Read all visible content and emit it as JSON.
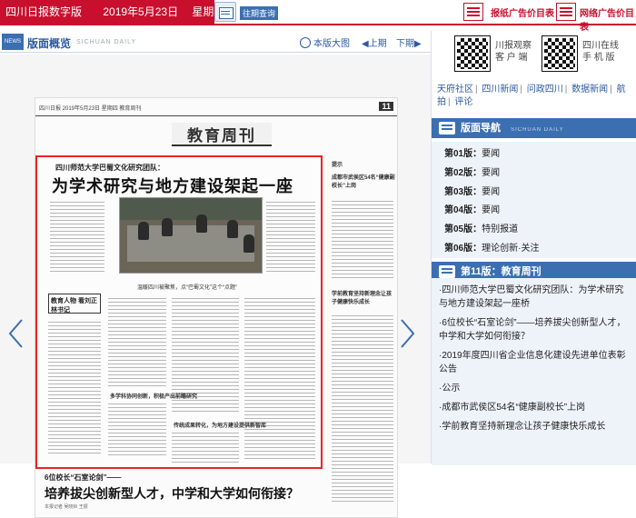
{
  "topbar": {
    "site_name": "四川日报数字版",
    "date": "2019年5月23日",
    "weekday": "星期四",
    "past_issues": "往期查询",
    "ad_price_1": "报纸广告价目表",
    "ad_price_2": "网络广告价目表",
    "news_badge": "NEWS"
  },
  "subheader": {
    "title": "版面概览",
    "title_en": "SICHUAN DAILY",
    "view_big": "本版大图",
    "prev": "◀上期",
    "next": "下期▶"
  },
  "newspaper": {
    "masthead_small": "四川日报  2019年5月23日  星期四  教育周刊",
    "page_num": "11",
    "section_title": "教育周刊",
    "kicker": "四川师范大学巴蜀文化研究团队：",
    "headline": "为学术研究与地方建设架起一座桥",
    "deck": "温暖四川被聚焦，点“巴蜀文化”这个“点题”",
    "sidebox": "教育人物 看刘正林书记",
    "sub1": "多学科协同创新，积极产出前瞻研究",
    "sub2": "传统成果转化，为地方建设提供新智库",
    "bottom_kicker": "6位校长“石室论剑”——",
    "bottom_headline": "培养拔尖创新型人才，中学和大学如何衔接？",
    "bottom_byline": "本报记者 吴晓铃 王振",
    "right_kicker_1": "成都市武侯区54名“健康副校长”上岗",
    "right_kicker_2": "学前教育坚持新理念让孩子健康快乐成长",
    "right_kicker_3": "提示"
  },
  "sidebar": {
    "qr1_label_1": "川报观察",
    "qr1_label_2": "客 户 端",
    "qr2_label_1": "四川在线",
    "qr2_label_2": "手 机 版",
    "links": [
      "天府社区",
      "四川新闻",
      "问政四川",
      "数据新闻",
      "航拍",
      "评论"
    ],
    "page_nav_title": "版面导航",
    "page_nav_en": "SICHUAN DAILY",
    "pages": [
      {
        "num": "第01版：",
        "name": "要闻"
      },
      {
        "num": "第02版：",
        "name": "要闻"
      },
      {
        "num": "第03版：",
        "name": "要闻"
      },
      {
        "num": "第04版：",
        "name": "要闻"
      },
      {
        "num": "第05版：",
        "name": "特别报道"
      },
      {
        "num": "第06版：",
        "name": "理论创新·关注"
      }
    ],
    "current_page_title": "第11版：教育周刊",
    "articles": [
      "·四川师范大学巴蜀文化研究团队：为学术研究与地方建设架起一座桥",
      "·6位校长“石室论剑”——培养拔尖创新型人才，中学和大学如何衔接？",
      "·2019年度四川省企业信息化建设先进单位表彰公告",
      "·公示",
      "·成都市武侯区54名“健康副校长”上岗",
      "·学前教育坚持新理念让孩子健康快乐成长"
    ]
  },
  "colors": {
    "brand_red": "#c8102e",
    "nav_blue": "#3b6fb2",
    "highlight_red": "#e22222"
  }
}
